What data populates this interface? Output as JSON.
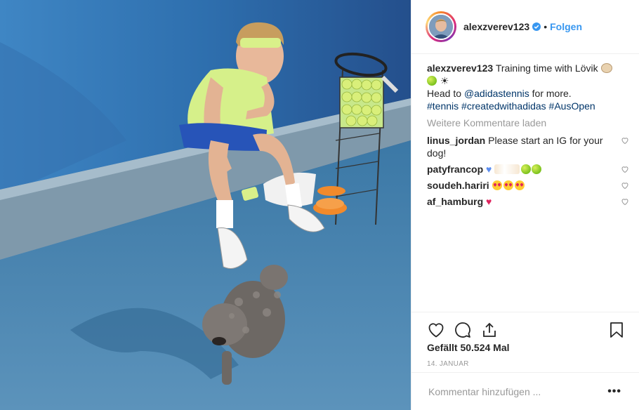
{
  "post": {
    "image_alt": "Tennis player in lime shirt sitting on court ledge with a small curly grey dog, ball basket with racquet, orange cones",
    "account": {
      "username": "alexzverev123",
      "separator": "•",
      "follow_label": "Folgen"
    },
    "caption": {
      "username": "alexzverev123",
      "text_1": "Training time with Lövik",
      "text_2": "Head to",
      "mention": "@adidastennis",
      "text_3": "for more.",
      "hashtags": "#tennis #createdwithadidas #AusOpen"
    },
    "load_more_label": "Weitere Kommentare laden",
    "comments": [
      {
        "username": "linus_jordan",
        "text": "Please start an IG for your dog!"
      },
      {
        "username": "patyfrancop",
        "text": ""
      },
      {
        "username": "soudeh.hariri",
        "text": ""
      },
      {
        "username": "af_hamburg",
        "text": ""
      }
    ],
    "likes_text": "Gefällt 50.524 Mal",
    "date_text": "14. JANUAR",
    "comment_input": {
      "placeholder": "Kommentar hinzufügen ..."
    },
    "more_options_label": "•••"
  },
  "colors": {
    "link": "#003569",
    "follow": "#3897f0",
    "muted": "#999999",
    "verified": "#3897f0"
  }
}
